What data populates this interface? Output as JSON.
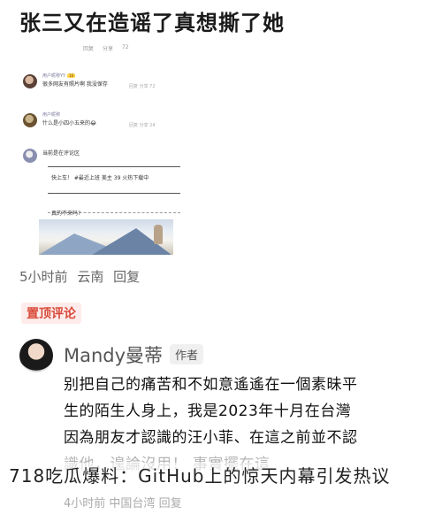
{
  "title": "张三又在造谣了真想撕了她",
  "embedded": {
    "top_stats": [
      "回复",
      "分享",
      "72"
    ],
    "comments": [
      {
        "name": "用户昵称YY",
        "badge": "16",
        "text": "很多网友有照片啊 我没保存",
        "meta": "回复 分享 72"
      },
      {
        "name": "用户昵称",
        "badge": "",
        "text": "什么是小四小五来的😂",
        "meta": "回复 分享 24"
      },
      {
        "name": "",
        "badge": "",
        "text": "当前是在评论区",
        "meta": ""
      }
    ],
    "quote_lines": [
      "快上车！ #最近上班 美主 39 火热下载中",
      "真的不来吗?"
    ]
  },
  "meta": {
    "time": "5小时前",
    "place": "云南",
    "reply": "回复"
  },
  "pinned_label": "置顶评论",
  "author": {
    "name": "Mandy曼蒂",
    "tag": "作者"
  },
  "body_lines": [
    "别把自己的痛苦和不如意遙遙在一個素昧平",
    "生的陌生人身上，我是2023年十月在台灣",
    "因為朋友才認識的汪小菲、在這之前並不認",
    "識他，遑論沒用！ 事實擺在這"
  ],
  "meta2": {
    "time": "4小时前",
    "place": "中国台湾",
    "reply": "回复"
  },
  "overlay_text": "718吃瓜爆料：GitHub上的惊天内幕引发热议"
}
